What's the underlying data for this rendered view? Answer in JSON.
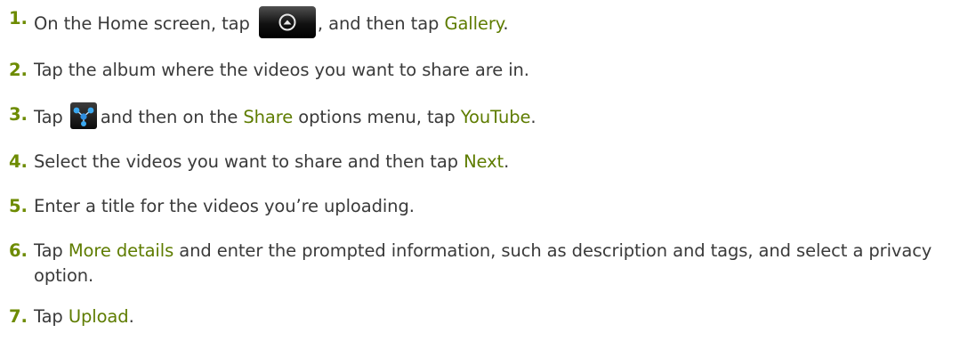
{
  "steps": [
    {
      "num": "1.",
      "t1": "On the Home screen, tap",
      "t2": ", and then tap",
      "h1": "Gallery",
      "t3": "."
    },
    {
      "num": "2.",
      "t1": "Tap the album where the videos you want to share are in."
    },
    {
      "num": "3.",
      "t1": "Tap",
      "t2": "and then on the",
      "h1": "Share",
      "t3": "options menu, tap",
      "h2": "YouTube",
      "t4": "."
    },
    {
      "num": "4.",
      "t1": "Select the videos you want to share and then tap",
      "h1": "Next",
      "t2": "."
    },
    {
      "num": "5.",
      "t1": "Enter a title for the videos you’re uploading."
    },
    {
      "num": "6.",
      "t1": "Tap",
      "h1": "More details",
      "t2": "and enter the prompted information, such as description and tags, and select a privacy option."
    },
    {
      "num": "7.",
      "t1": "Tap",
      "h1": "Upload",
      "t2": "."
    }
  ],
  "icons": {
    "home_button": "all-apps-up-arrow-icon",
    "share": "share-icon"
  },
  "colors": {
    "text": "#3a3a3a",
    "step_number": "#6d8b00",
    "highlight": "#5e7c00"
  }
}
